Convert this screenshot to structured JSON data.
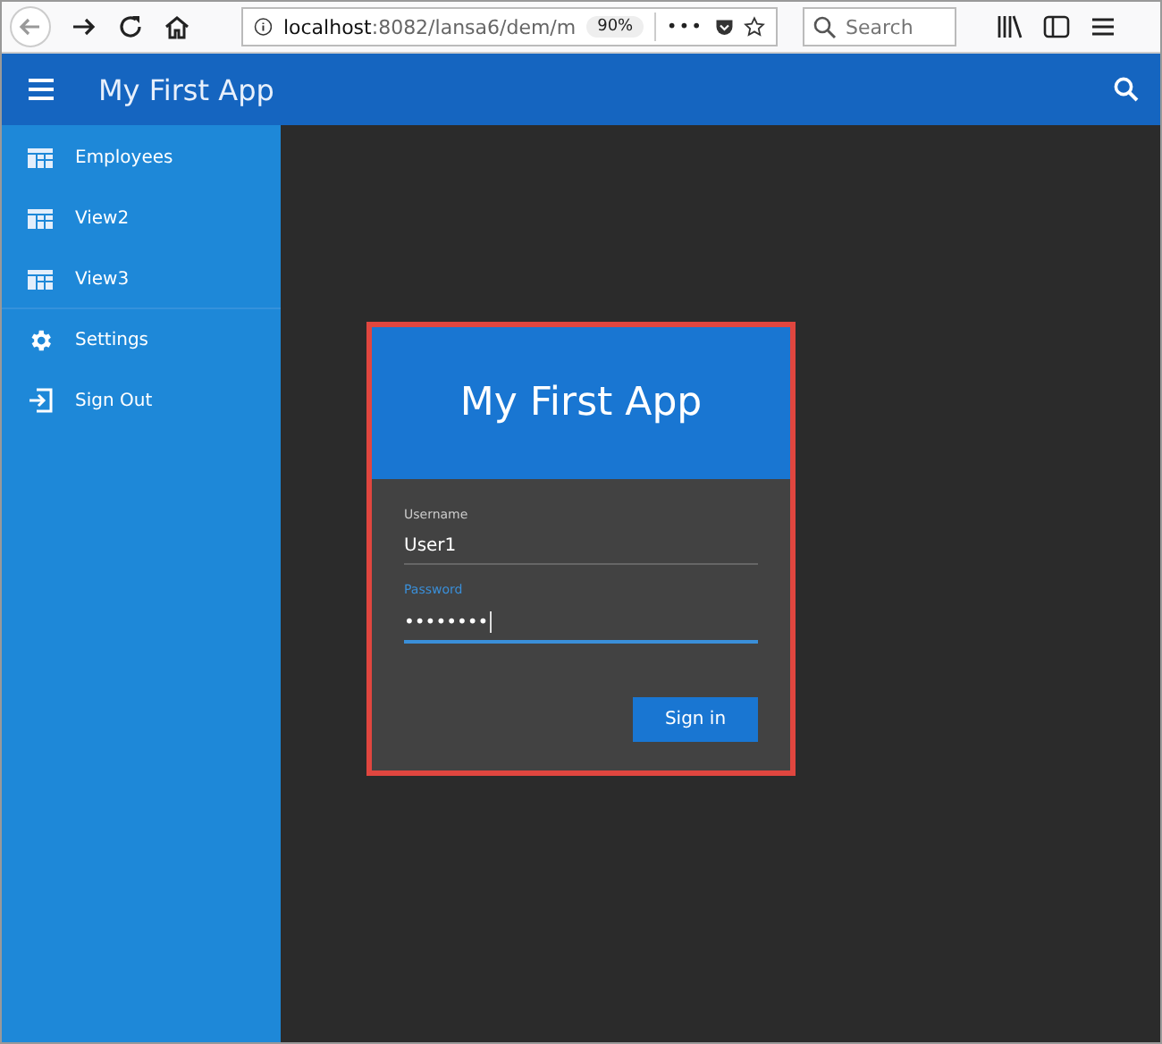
{
  "browser": {
    "url_host": "localhost",
    "url_rest": ":8082/lansa6/dem/m",
    "zoom": "90%",
    "more": "•••",
    "search": {
      "placeholder": "Search"
    }
  },
  "app_bar": {
    "title": "My First App"
  },
  "sidebar": {
    "items": [
      {
        "label": "Employees",
        "kind": "grid",
        "divider_before": false
      },
      {
        "label": "View2",
        "kind": "grid",
        "divider_before": false
      },
      {
        "label": "View3",
        "kind": "grid",
        "divider_before": false
      },
      {
        "label": "Settings",
        "kind": "gear",
        "divider_before": true
      },
      {
        "label": "Sign Out",
        "kind": "exit",
        "divider_before": false
      }
    ]
  },
  "login": {
    "title": "My First App",
    "highlighted": true,
    "fields": [
      {
        "label": "Username",
        "value": "User1",
        "focused": false
      },
      {
        "label": "Password",
        "value": "••••••••",
        "focused": true
      }
    ],
    "button": "Sign in"
  }
}
